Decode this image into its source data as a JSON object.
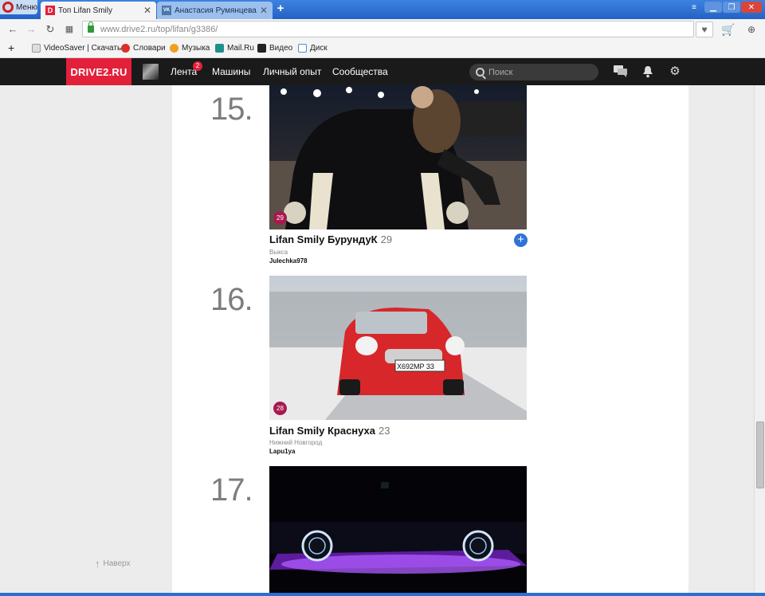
{
  "browser": {
    "menu_label": "Меню",
    "tabs": [
      {
        "label": "Топ Lifan Smily",
        "favicon": "D",
        "active": true
      },
      {
        "label": "Анастасия Румянцева",
        "favicon": "VK",
        "active": false
      }
    ],
    "new_tab": "+",
    "url": "www.drive2.ru/top/lifan/g3386/",
    "bookmarks": [
      {
        "label": "VideoSaver | Скачать в",
        "icon": "page-icon"
      },
      {
        "label": "Словари",
        "icon": "dictionary-icon"
      },
      {
        "label": "Музыка",
        "icon": "music-icon"
      },
      {
        "label": "Mail.Ru",
        "icon": "mailru-icon"
      },
      {
        "label": "Видео",
        "icon": "video-icon"
      },
      {
        "label": "Диск",
        "icon": "disk-icon"
      }
    ]
  },
  "site": {
    "logo": "DRIVE2.RU",
    "nav": [
      {
        "label": "Лента",
        "badge": "2"
      },
      {
        "label": "Машины"
      },
      {
        "label": "Личный опыт"
      },
      {
        "label": "Сообщества"
      }
    ],
    "search_placeholder": "Поиск",
    "accent_color": "#e3203a"
  },
  "entries": [
    {
      "rank": "15.",
      "likes": "29",
      "title": "Lifan Smily БурундуК",
      "count": "29",
      "city": "Выкса",
      "user": "Julechka978",
      "has_follow": true
    },
    {
      "rank": "16.",
      "likes": "28",
      "title": "Lifan Smily Краснуха",
      "count": "23",
      "city": "Нижний Новгород",
      "user": "Lapu1ya",
      "has_follow": false
    },
    {
      "rank": "17.",
      "likes": "",
      "title": "",
      "count": "",
      "city": "",
      "user": "",
      "has_follow": false
    }
  ],
  "plate_text": "X692MP 33",
  "to_top": "Наверх"
}
